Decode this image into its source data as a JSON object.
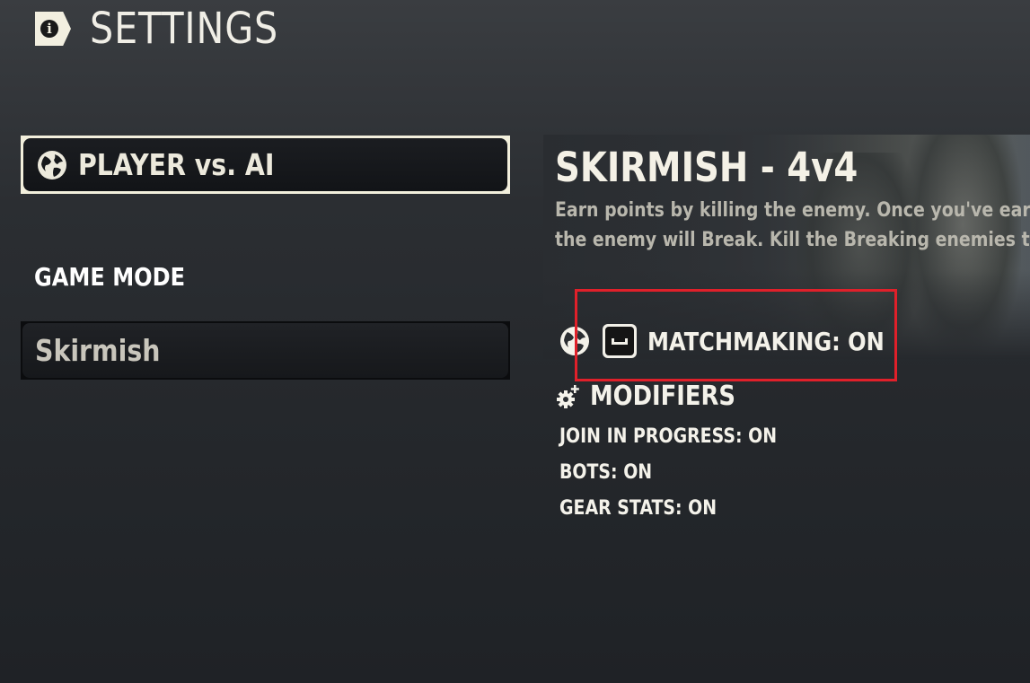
{
  "header": {
    "title": "SETTINGS",
    "icon": "info-icon"
  },
  "left": {
    "mode_select_label": "PLAYER vs. AI",
    "section_label": "GAME MODE",
    "game_mode_value": "Skirmish"
  },
  "detail": {
    "title": "SKIRMISH - 4v4",
    "description_line1": "Earn points by killing the enemy. Once you've earn",
    "description_line2": "the enemy will Break. Kill the Breaking enemies to",
    "matchmaking": "MATCHMAKING: ON",
    "modifiers_title": "MODIFIERS",
    "modifiers": [
      "JOIN IN PROGRESS: ON",
      "BOTS: ON",
      "GEAR STATS: ON"
    ]
  },
  "colors": {
    "highlight": "#e0202a",
    "text": "#f4f2ea",
    "selected_border": "#f2efdc"
  }
}
